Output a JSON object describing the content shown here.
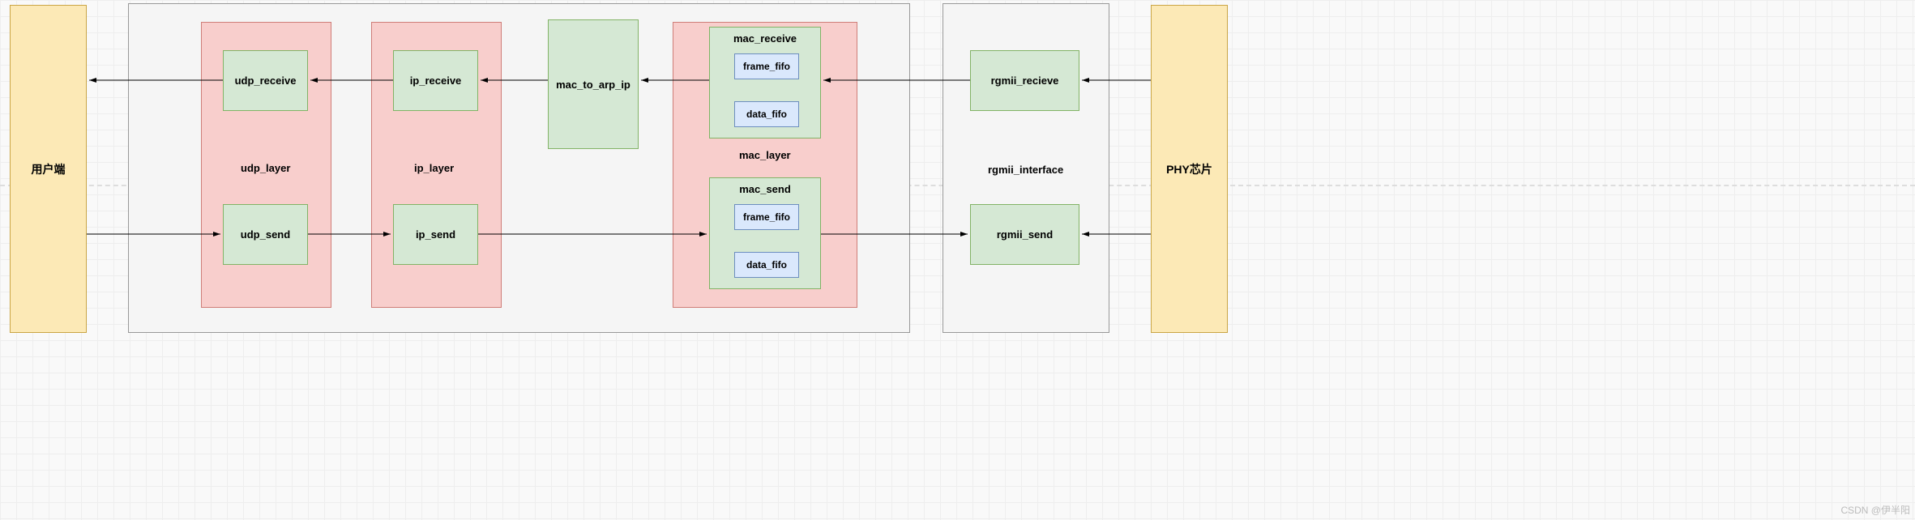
{
  "endpoints": {
    "user": "用户端",
    "phy": "PHY芯片"
  },
  "container": {
    "main": "",
    "rgmii_label": "rgmii_interface"
  },
  "udp_layer": {
    "label": "udp_layer",
    "receive": "udp_receive",
    "send": "udp_send"
  },
  "ip_layer": {
    "label": "ip_layer",
    "receive": "ip_receive",
    "send": "ip_send"
  },
  "mac_to_arp_ip": "mac_to_arp_ip",
  "mac_layer": {
    "label": "mac_layer",
    "receive": {
      "label": "mac_receive",
      "frame_fifo": "frame_fifo",
      "data_fifo": "data_fifo"
    },
    "send": {
      "label": "mac_send",
      "frame_fifo": "frame_fifo",
      "data_fifo": "data_fifo"
    }
  },
  "rgmii": {
    "receive": "rgmii_recieve",
    "send": "rgmii_send"
  },
  "watermark": "CSDN @伊半阳"
}
